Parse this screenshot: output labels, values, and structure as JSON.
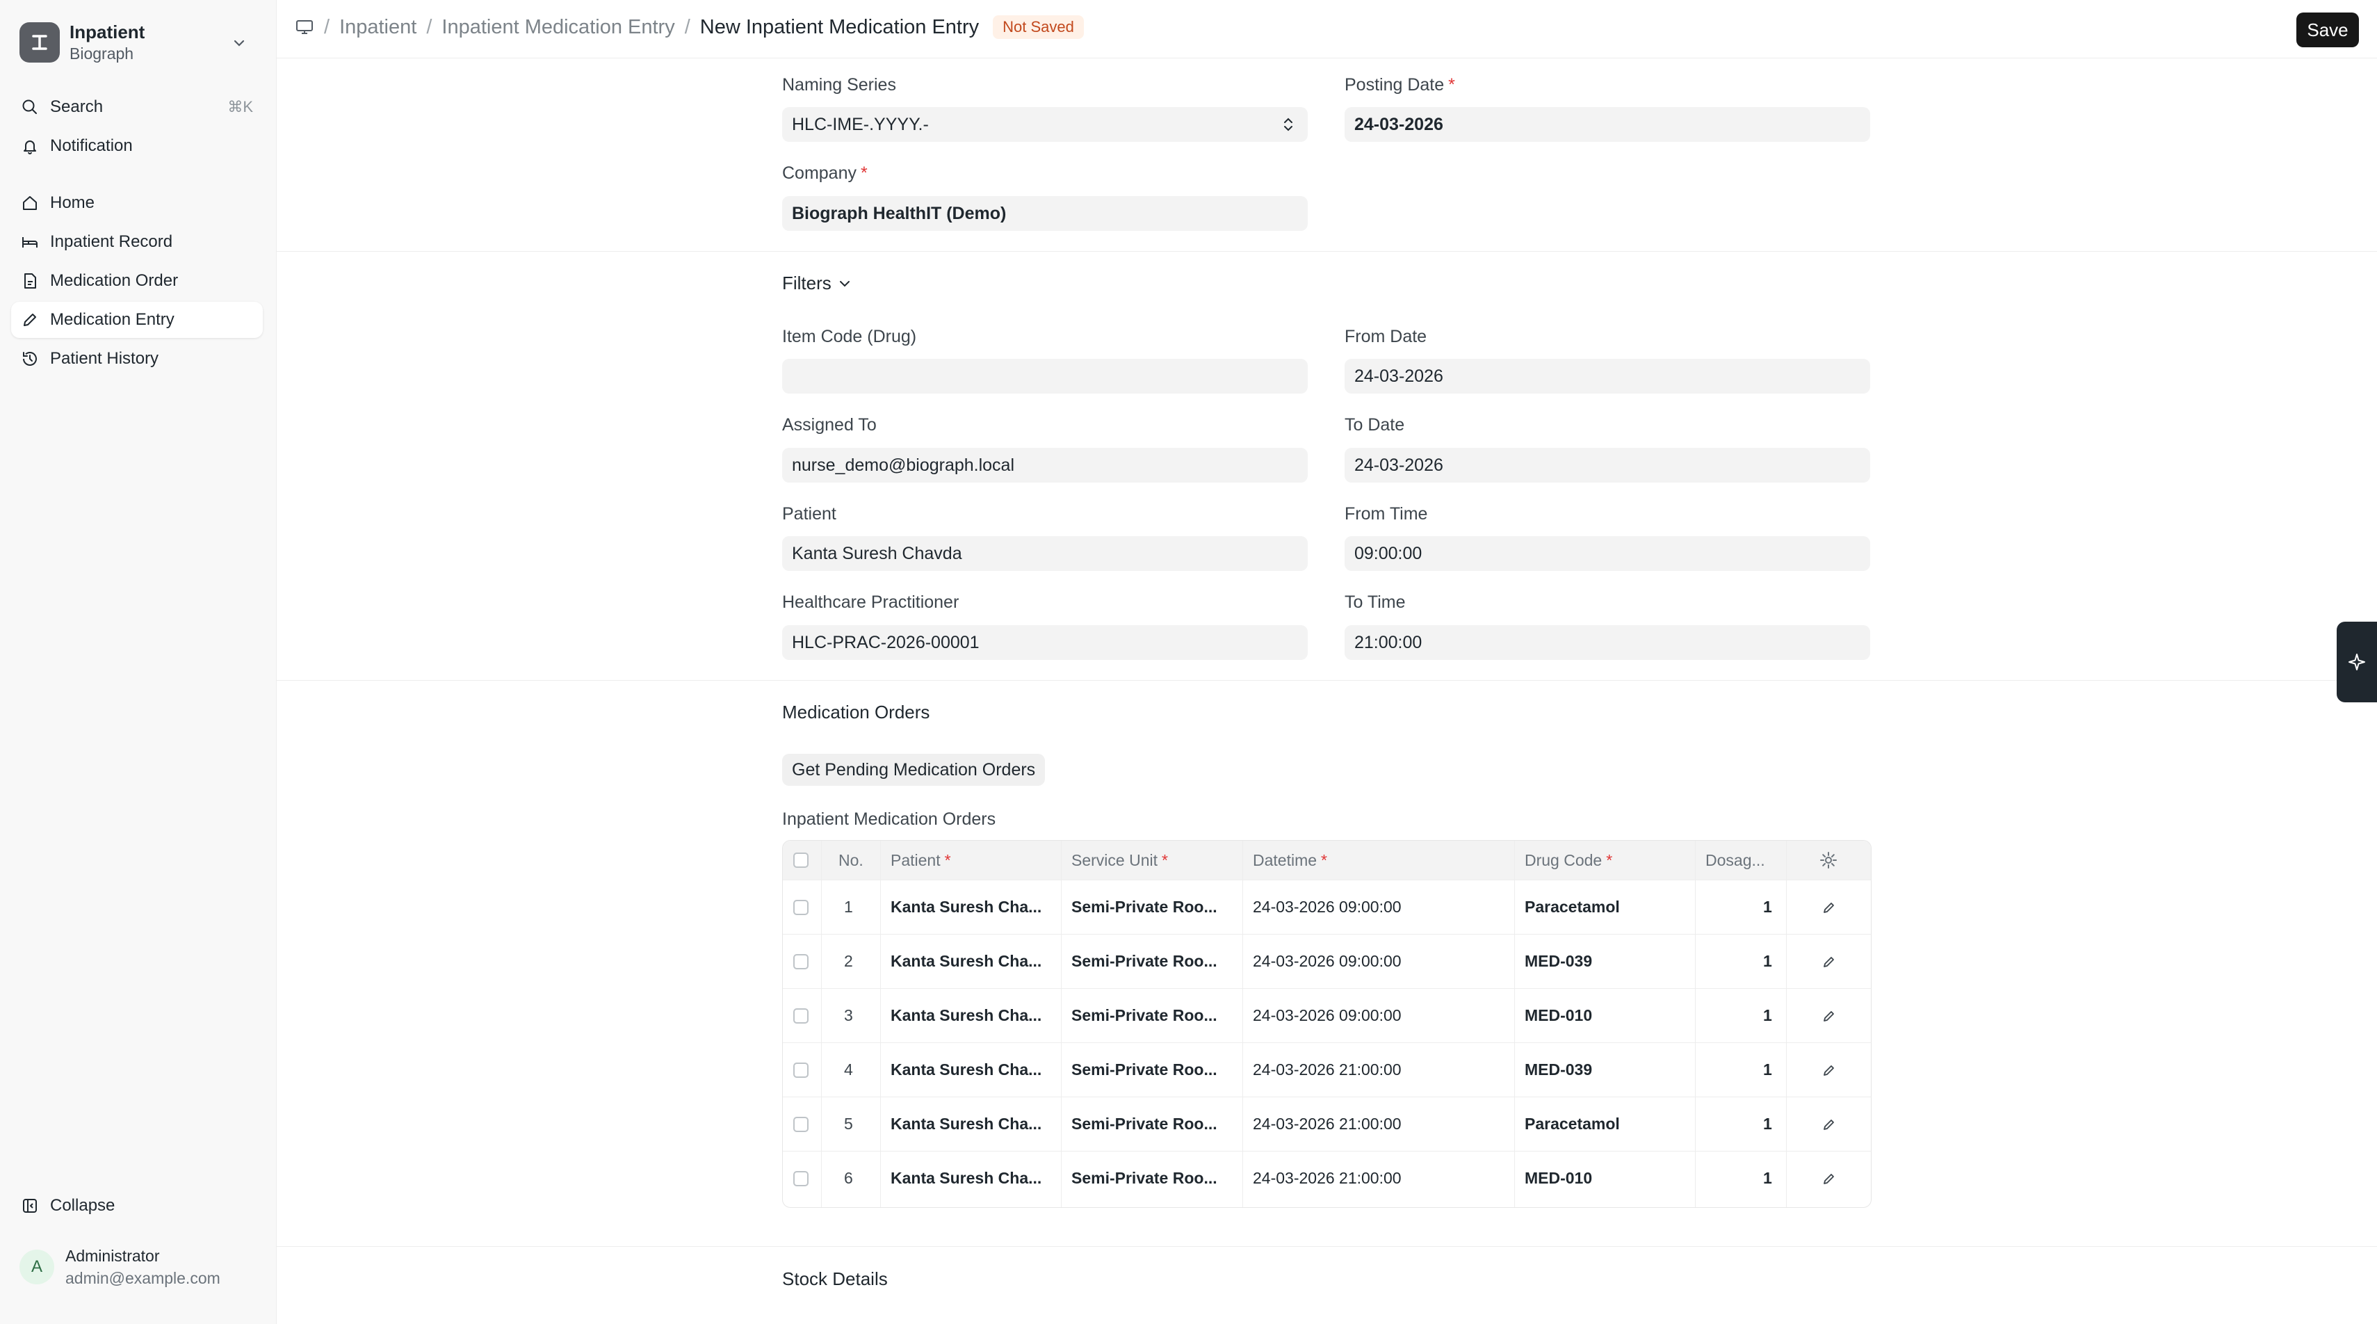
{
  "app": {
    "title": "Inpatient",
    "subtitle": "Biograph"
  },
  "sidebar": {
    "search_label": "Search",
    "search_shortcut": "⌘K",
    "notification_label": "Notification",
    "items": [
      {
        "label": "Home",
        "icon": "home-icon"
      },
      {
        "label": "Inpatient Record",
        "icon": "bed-icon"
      },
      {
        "label": "Medication Order",
        "icon": "file-icon"
      },
      {
        "label": "Medication Entry",
        "icon": "pencil-icon"
      },
      {
        "label": "Patient History",
        "icon": "history-icon"
      }
    ],
    "collapse_label": "Collapse",
    "user": {
      "initial": "A",
      "name": "Administrator",
      "email": "admin@example.com"
    }
  },
  "header": {
    "breadcrumbs": [
      "Inpatient",
      "Inpatient Medication Entry"
    ],
    "current": "New Inpatient Medication Entry",
    "status": "Not Saved",
    "save_label": "Save"
  },
  "form": {
    "naming_series": {
      "label": "Naming Series",
      "value": "HLC-IME-.YYYY.-"
    },
    "posting_date": {
      "label": "Posting Date",
      "value": "24-03-2026"
    },
    "company": {
      "label": "Company",
      "value": "Biograph HealthIT (Demo)"
    },
    "filters_label": "Filters",
    "item_code": {
      "label": "Item Code (Drug)",
      "value": ""
    },
    "from_date": {
      "label": "From Date",
      "value": "24-03-2026"
    },
    "assigned_to": {
      "label": "Assigned To",
      "value": "nurse_demo@biograph.local"
    },
    "to_date": {
      "label": "To Date",
      "value": "24-03-2026"
    },
    "patient": {
      "label": "Patient",
      "value": "Kanta Suresh Chavda"
    },
    "from_time": {
      "label": "From Time",
      "value": "09:00:00"
    },
    "practitioner": {
      "label": "Healthcare Practitioner",
      "value": "HLC-PRAC-2026-00001"
    },
    "to_time": {
      "label": "To Time",
      "value": "21:00:00"
    }
  },
  "medication": {
    "section_title": "Medication Orders",
    "pending_button": "Get Pending Medication Orders",
    "table_label": "Inpatient Medication Orders",
    "columns": {
      "no": "No.",
      "patient": "Patient",
      "service_unit": "Service Unit",
      "datetime": "Datetime",
      "drug_code": "Drug Code",
      "dosage": "Dosag..."
    },
    "rows": [
      {
        "no": "1",
        "patient": "Kanta Suresh Cha...",
        "service_unit": "Semi-Private Roo...",
        "datetime": "24-03-2026 09:00:00",
        "drug_code": "Paracetamol",
        "dosage": "1"
      },
      {
        "no": "2",
        "patient": "Kanta Suresh Cha...",
        "service_unit": "Semi-Private Roo...",
        "datetime": "24-03-2026 09:00:00",
        "drug_code": "MED-039",
        "dosage": "1"
      },
      {
        "no": "3",
        "patient": "Kanta Suresh Cha...",
        "service_unit": "Semi-Private Roo...",
        "datetime": "24-03-2026 09:00:00",
        "drug_code": "MED-010",
        "dosage": "1"
      },
      {
        "no": "4",
        "patient": "Kanta Suresh Cha...",
        "service_unit": "Semi-Private Roo...",
        "datetime": "24-03-2026 21:00:00",
        "drug_code": "MED-039",
        "dosage": "1"
      },
      {
        "no": "5",
        "patient": "Kanta Suresh Cha...",
        "service_unit": "Semi-Private Roo...",
        "datetime": "24-03-2026 21:00:00",
        "drug_code": "Paracetamol",
        "dosage": "1"
      },
      {
        "no": "6",
        "patient": "Kanta Suresh Cha...",
        "service_unit": "Semi-Private Roo...",
        "datetime": "24-03-2026 21:00:00",
        "drug_code": "MED-010",
        "dosage": "1"
      }
    ]
  },
  "stock": {
    "section_title": "Stock Details"
  }
}
